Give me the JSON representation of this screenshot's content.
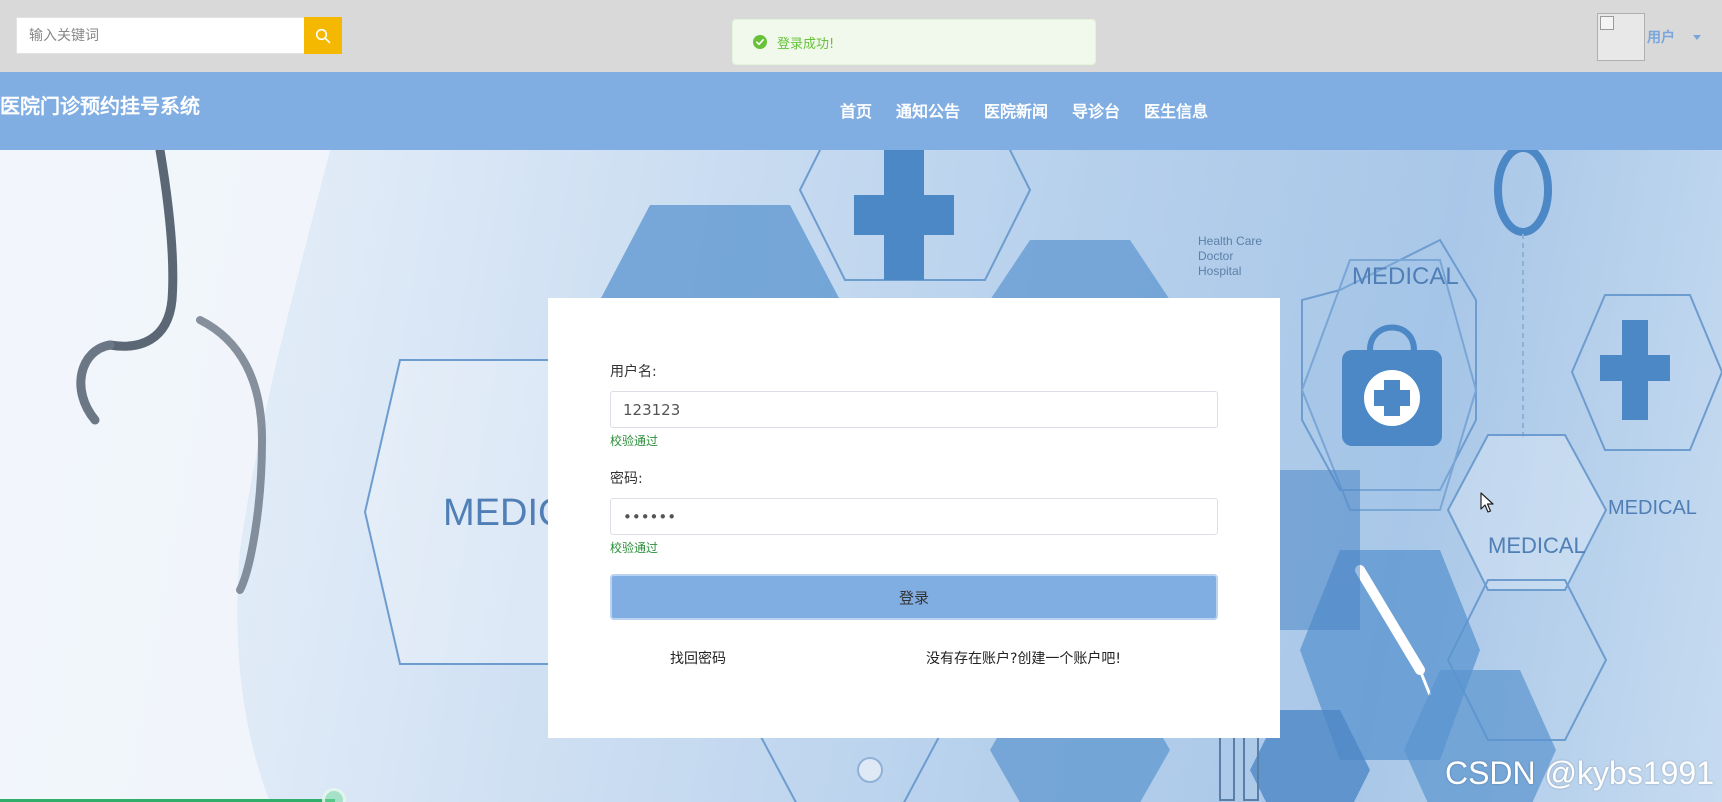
{
  "topbar": {
    "search_placeholder": "输入关键词",
    "toast_text": "登录成功!",
    "user_label": "用户"
  },
  "header": {
    "site_title": "医院门诊预约挂号系统",
    "nav": [
      "首页",
      "通知公告",
      "医院新闻",
      "导诊台",
      "医生信息"
    ]
  },
  "hero": {
    "medical_labels": [
      "MEDICA",
      "MEDICAL",
      "MEDICAL",
      "MEDICAL"
    ],
    "health_lines": [
      "Health Care",
      "Doctor",
      "Hospital"
    ]
  },
  "form": {
    "username_label": "用户名:",
    "username_value": "123123",
    "username_status": "校验通过",
    "password_label": "密码:",
    "password_value": "123123",
    "password_status": "校验通过",
    "login_label": "登录",
    "forgot_link": "找回密码",
    "register_link": "没有存在账户?创建一个账户吧!"
  },
  "watermark": "CSDN @kybs1991",
  "colors": {
    "accent": "#80ade2",
    "search_button": "#f5b800",
    "success": "#67c23a",
    "valid_text": "#2c8f3a"
  }
}
